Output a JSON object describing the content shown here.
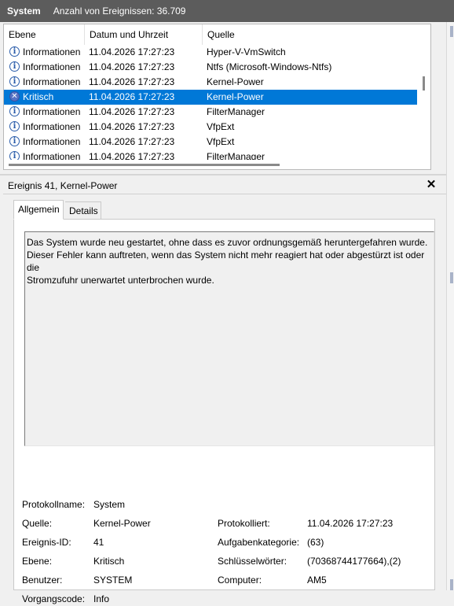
{
  "header": {
    "title": "System",
    "count_text": "Anzahl von Ereignissen: 36.709"
  },
  "columns": {
    "level": "Ebene",
    "datetime": "Datum und Uhrzeit",
    "source": "Quelle"
  },
  "events": [
    {
      "level": "Informationen",
      "datetime": "11.04.2026 17:27:23",
      "source": "Hyper-V-VmSwitch",
      "icon": "info-icon"
    },
    {
      "level": "Informationen",
      "datetime": "11.04.2026 17:27:23",
      "source": "Ntfs (Microsoft-Windows-Ntfs)",
      "icon": "info-icon"
    },
    {
      "level": "Informationen",
      "datetime": "11.04.2026 17:27:23",
      "source": "Kernel-Power",
      "icon": "info-icon"
    },
    {
      "level": "Kritisch",
      "datetime": "11.04.2026 17:27:23",
      "source": "Kernel-Power",
      "icon": "critical-icon"
    },
    {
      "level": "Informationen",
      "datetime": "11.04.2026 17:27:23",
      "source": "FilterManager",
      "icon": "info-icon"
    },
    {
      "level": "Informationen",
      "datetime": "11.04.2026 17:27:23",
      "source": "VfpExt",
      "icon": "info-icon"
    },
    {
      "level": "Informationen",
      "datetime": "11.04.2026 17:27:23",
      "source": "VfpExt",
      "icon": "info-icon"
    },
    {
      "level": "Informationen",
      "datetime": "11.04.2026 17:27:23",
      "source": "FilterManager",
      "icon": "info-icon"
    }
  ],
  "detail": {
    "title": "Ereignis 41, Kernel-Power",
    "close_glyph": "✕",
    "tabs": {
      "general": "Allgemein",
      "details": "Details"
    },
    "description": "Das System wurde neu gestartet, ohne dass es zuvor ordnungsgemäß heruntergefahren wurde.\nDieser Fehler kann auftreten, wenn das System nicht mehr reagiert hat oder abgestürzt ist oder die\nStromzufuhr unerwartet unterbrochen wurde.",
    "fields": {
      "log_name_label": "Protokollname:",
      "log_name": "System",
      "source_label": "Quelle:",
      "source": "Kernel-Power",
      "logged_label": "Protokolliert:",
      "logged": "11.04.2026 17:27:23",
      "event_id_label": "Ereignis-ID:",
      "event_id": "41",
      "task_category_label": "Aufgabenkategorie:",
      "task_category": "(63)",
      "level_label": "Ebene:",
      "level": "Kritisch",
      "keywords_label": "Schlüsselwörter:",
      "keywords": "(70368744177664),(2)",
      "user_label": "Benutzer:",
      "user": "SYSTEM",
      "computer_label": "Computer:",
      "computer": "AM5",
      "opcode_label": "Vorgangscode:",
      "opcode": "Info"
    }
  },
  "colors": {
    "header_bg": "#5c5c5c",
    "selection": "#0078d7",
    "info_icon": "#2a5caa",
    "critical_icon": "#5672c5"
  }
}
